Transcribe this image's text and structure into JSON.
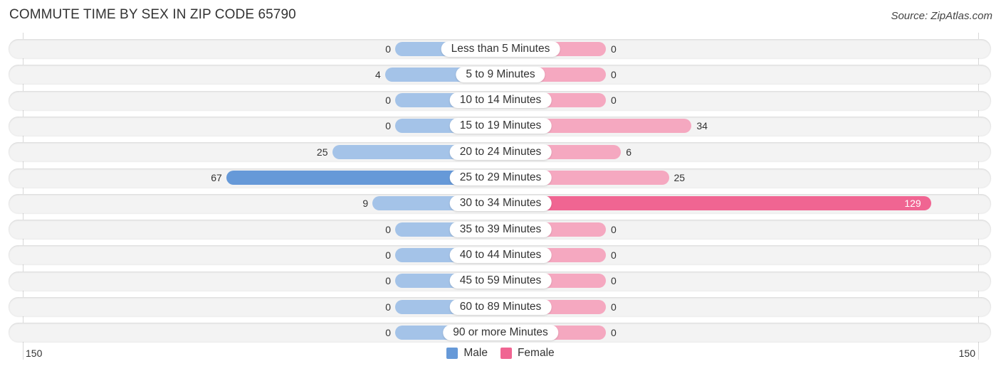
{
  "title": "COMMUTE TIME BY SEX IN ZIP CODE 65790",
  "source": "Source: ZipAtlas.com",
  "colors": {
    "male": "#a4c3e8",
    "male_strong": "#6699d8",
    "female": "#f5a8c0",
    "female_strong": "#f06592"
  },
  "chart_data": {
    "type": "bar",
    "orientation": "horizontal-diverging",
    "title": "COMMUTE TIME BY SEX IN ZIP CODE 65790",
    "categories": [
      "Less than 5 Minutes",
      "5 to 9 Minutes",
      "10 to 14 Minutes",
      "15 to 19 Minutes",
      "20 to 24 Minutes",
      "25 to 29 Minutes",
      "30 to 34 Minutes",
      "35 to 39 Minutes",
      "40 to 44 Minutes",
      "45 to 59 Minutes",
      "60 to 89 Minutes",
      "90 or more Minutes"
    ],
    "series": [
      {
        "name": "Male",
        "values": [
          0,
          4,
          0,
          0,
          25,
          67,
          9,
          0,
          0,
          0,
          0,
          0
        ]
      },
      {
        "name": "Female",
        "values": [
          0,
          0,
          0,
          34,
          6,
          25,
          129,
          0,
          0,
          0,
          0,
          0
        ]
      }
    ],
    "axis": {
      "left_label": "150",
      "right_label": "150",
      "max": 150
    },
    "legend": [
      {
        "name": "Male"
      },
      {
        "name": "Female"
      }
    ],
    "legend_position": "bottom-center"
  }
}
